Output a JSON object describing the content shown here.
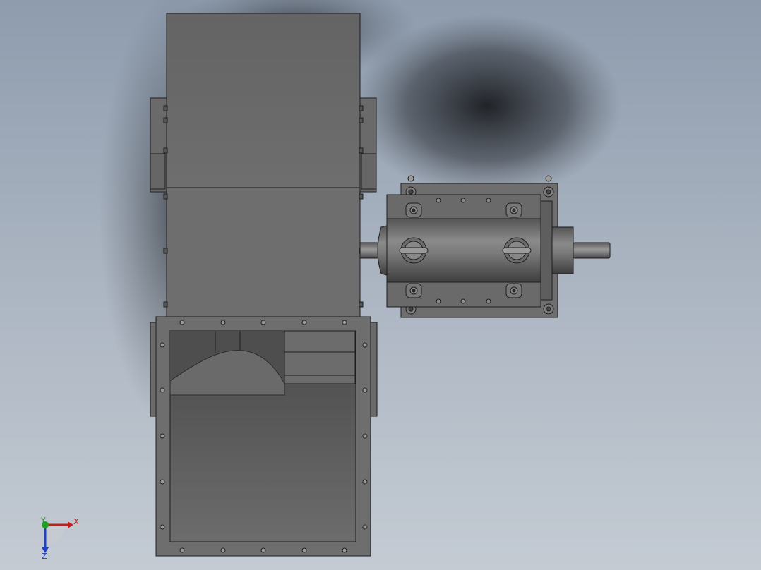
{
  "viewport": {
    "background_top": "#8e9cae",
    "background_bottom": "#c4cbd3"
  },
  "model": {
    "body_color": "#6a6a6a",
    "edge_color": "#1e1e1e",
    "opening_color": "#5e5e5e"
  },
  "triad": {
    "x_label": "X",
    "y_label": "Y",
    "z_label": "Z",
    "x_color": "#c02020",
    "y_color": "#20a020",
    "z_color": "#2040c0"
  }
}
